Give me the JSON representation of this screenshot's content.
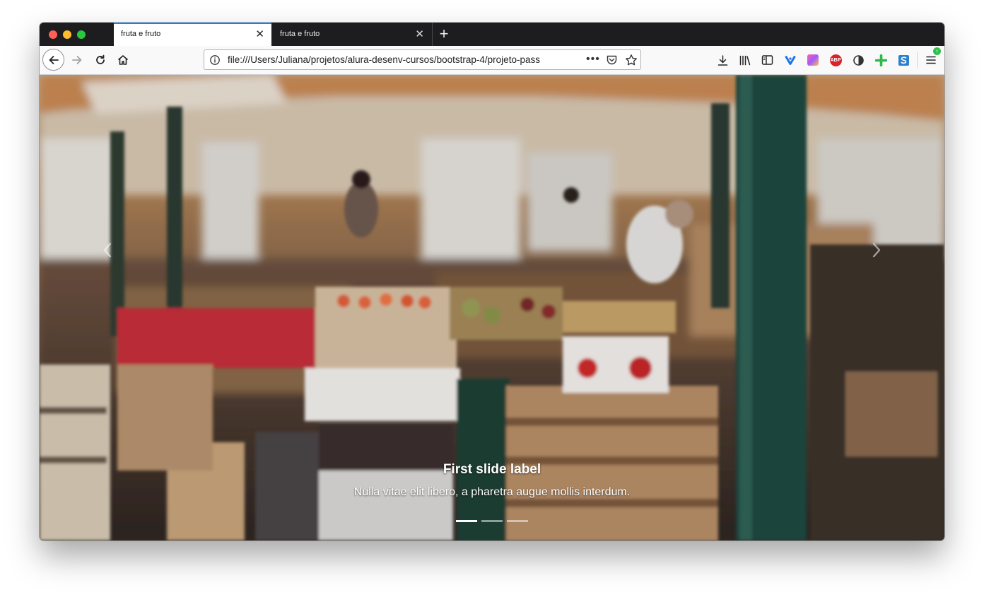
{
  "browser": {
    "tabs": [
      {
        "title": "fruta e fruto",
        "active": true
      },
      {
        "title": "fruta e fruto",
        "active": false
      }
    ],
    "url": "file:///Users/Juliana/projetos/alura-desenv-cursos/bootstrap-4/projeto-pass",
    "accent_color": "#0a84ff",
    "toolbar_icons": [
      "download-icon",
      "library-icon",
      "sidebar-icon",
      "vivaldi-extension-icon",
      "gradient-extension-icon",
      "adblock-plus-icon",
      "privacy-extension-icon",
      "green-plus-extension-icon",
      "s-extension-icon",
      "menu-icon"
    ],
    "adblock_label": "ABP"
  },
  "carousel": {
    "caption_title": "First slide label",
    "caption_text": "Nulla vitae elit libero, a pharetra augue mollis interdum.",
    "slides": 3,
    "active_slide": 1,
    "image": "market-stall-photo"
  }
}
